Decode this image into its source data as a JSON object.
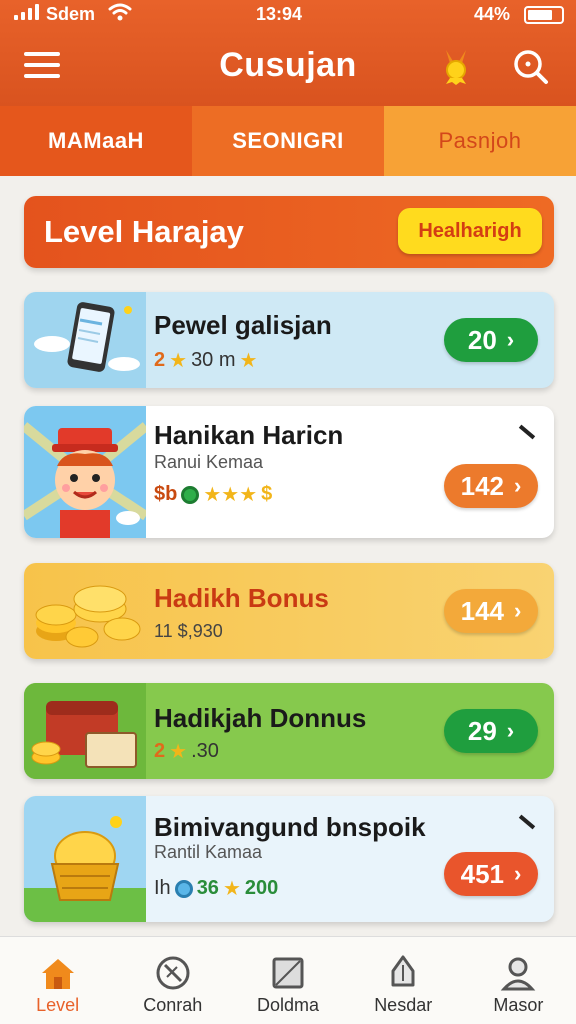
{
  "status": {
    "carrier": "Sdem",
    "time": "13:94",
    "battery": "44%"
  },
  "header": {
    "title": "Cusujan"
  },
  "tabs": [
    {
      "label": "MAMaaH"
    },
    {
      "label": "SEONIGRI"
    },
    {
      "label": "Pasnjoh"
    }
  ],
  "banner": {
    "title": "Level Harajay",
    "button": "Healharigh"
  },
  "cards": [
    {
      "title": "Pewel galisjan",
      "meta_a": "2",
      "meta_b": "30 m",
      "pill": "20"
    },
    {
      "title": "Hanikan Haricn",
      "subtitle": "Ranui Kemaa",
      "meta_a": "$b",
      "pill": "142"
    },
    {
      "title": "Hadikh Bonus",
      "meta_a": "11 $,930",
      "pill": "144"
    },
    {
      "title": "Hadikjah Donnus",
      "meta_a": "2",
      "meta_b": ".30",
      "pill": "29"
    },
    {
      "title": "Bimivangund bnspoik",
      "subtitle": "Rantil Kamaa",
      "meta_a": "Ih",
      "meta_b": "36",
      "meta_c": "200",
      "pill": "451"
    }
  ],
  "nav": [
    {
      "label": "Level"
    },
    {
      "label": "Conrah"
    },
    {
      "label": "Doldma"
    },
    {
      "label": "Nesdar"
    },
    {
      "label": "Masor"
    }
  ],
  "colors": {
    "brand": "#e8622a",
    "green_pill": "#1f9e3e",
    "orange_pill": "#ec7a2c",
    "yellow_button": "#ffdb1e"
  }
}
